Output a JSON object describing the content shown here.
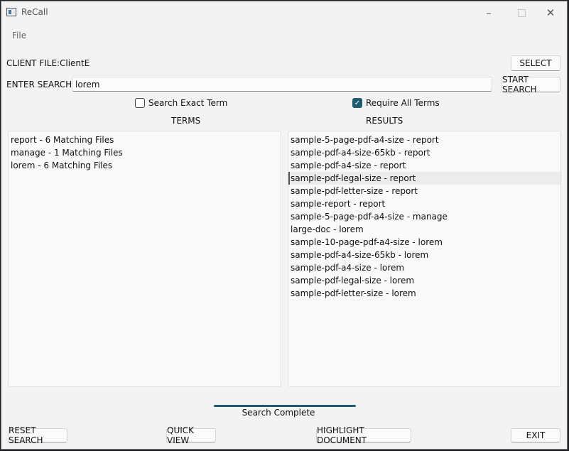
{
  "window": {
    "title": "ReCall",
    "icons": {
      "app": "app-icon",
      "minimize": "minimize-icon",
      "maximize": "maximize-icon",
      "close": "close-icon"
    }
  },
  "menu": {
    "file": "File"
  },
  "client": {
    "label": "CLIENT FILE:",
    "value": "ClientE",
    "select_button": "SELECT"
  },
  "search": {
    "label": "ENTER SEARCH",
    "value": "lorem",
    "start_button": "START SEARCH"
  },
  "options": {
    "exact": {
      "label": "Search Exact Term",
      "checked": false
    },
    "require_all": {
      "label": "Require All Terms",
      "checked": true
    }
  },
  "terms": {
    "header": "TERMS",
    "items": [
      "report - 6 Matching Files",
      "manage - 1 Matching Files",
      "lorem - 6 Matching Files"
    ]
  },
  "results": {
    "header": "RESULTS",
    "selected_index": 3,
    "items": [
      "sample-5-page-pdf-a4-size - report",
      "sample-pdf-a4-size-65kb - report",
      "sample-pdf-a4-size - report",
      "sample-pdf-legal-size - report",
      "sample-pdf-letter-size - report",
      "sample-report - report",
      "sample-5-page-pdf-a4-size - manage",
      "large-doc - lorem",
      "sample-10-page-pdf-a4-size - lorem",
      "sample-pdf-a4-size-65kb - lorem",
      "sample-pdf-a4-size - lorem",
      "sample-pdf-legal-size - lorem",
      "sample-pdf-letter-size - lorem"
    ]
  },
  "status": {
    "text": "Search Complete",
    "progress": 1.0
  },
  "buttons": {
    "reset": "RESET SEARCH",
    "quick_view": "QUICK VIEW",
    "highlight": "HIGHLIGHT DOCUMENT",
    "exit": "EXIT"
  },
  "colors": {
    "accent": "#1f5c70",
    "window_bg": "#f3f3f3",
    "list_bg": "#f9f9f9",
    "selection": "#ececec"
  }
}
